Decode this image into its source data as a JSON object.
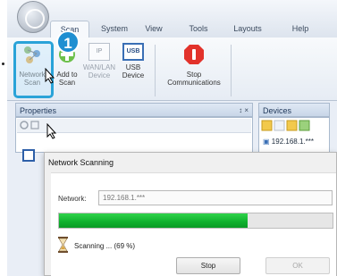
{
  "ribbon_tabs": [
    {
      "label": "Scan",
      "active": true
    },
    {
      "label": "System",
      "active": false
    },
    {
      "label": "View",
      "active": false
    },
    {
      "label": "Tools",
      "active": false
    },
    {
      "label": "Layouts",
      "active": false
    },
    {
      "label": "Help",
      "active": false
    }
  ],
  "ribbon_buttons": {
    "network_scan": {
      "line1": "Network",
      "line2": "Scan"
    },
    "add_wan": {
      "line1": "Add to",
      "line2": "Scan",
      "line2b": "WAN/LAN",
      "line3b": "Device"
    },
    "ip_badge": "IP",
    "usb_badge": "USB",
    "usb_device": {
      "line1": "USB",
      "line2": "Device"
    },
    "stop_comm": {
      "line1": "Stop",
      "line2": "Communications"
    }
  },
  "step_badge": "1",
  "panels": {
    "properties_title": "Properties",
    "properties_pin": "↕ ×",
    "devices_title": "Devices",
    "device_item": "192.168.1.***"
  },
  "dialog": {
    "title": "Network Scanning",
    "network_label": "Network:",
    "network_value": "192.168.1.***",
    "progress_percent": 69,
    "status_text": "Scanning ... (69 %)",
    "stop_label": "Stop",
    "ok_label": "OK"
  },
  "colors": {
    "accent": "#2aa3d8",
    "badge": "#1f8fd1",
    "progress": "#13b22f"
  }
}
